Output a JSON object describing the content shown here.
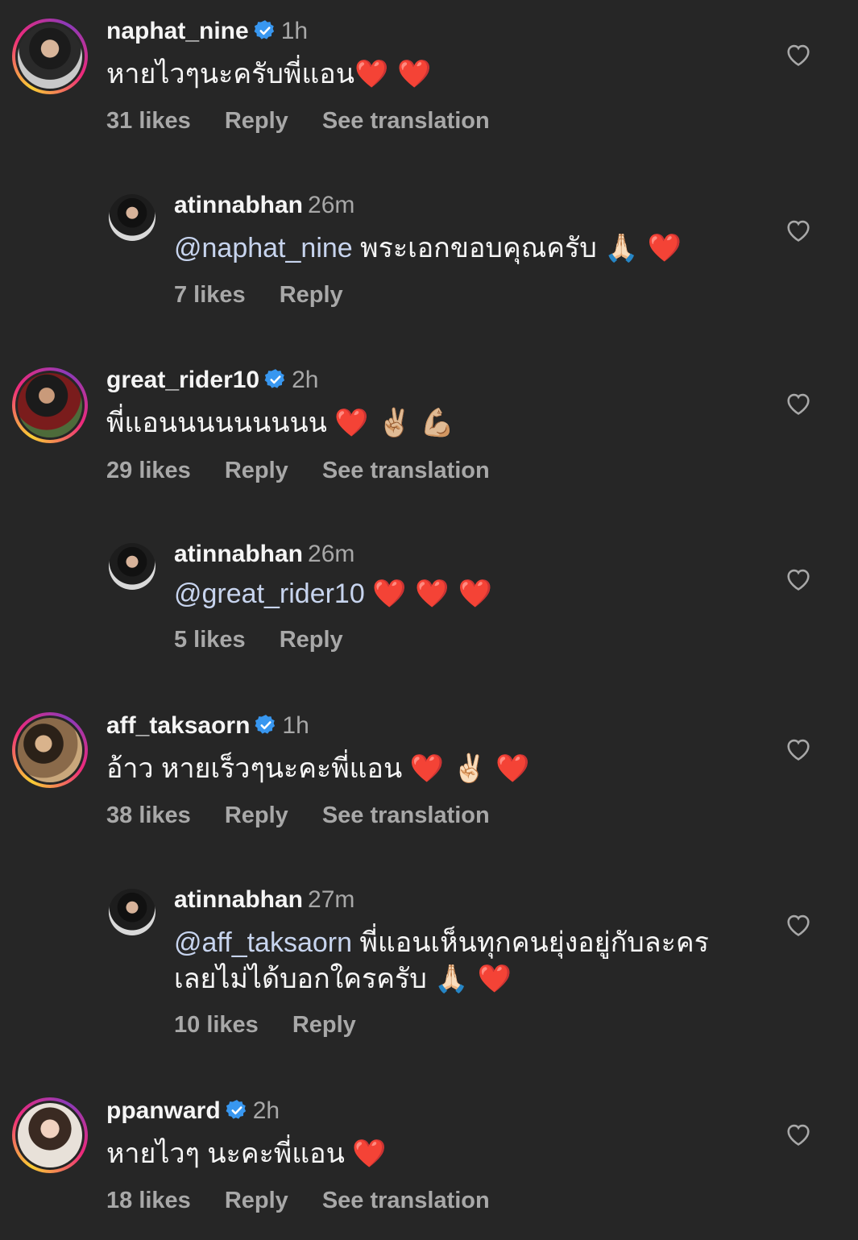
{
  "comments": [
    {
      "username": "naphat_nine",
      "verified": true,
      "time": "1h",
      "text": "หายไวๆนะครับพี่แอน",
      "emoji": "❤️ ❤️",
      "likes": "31 likes",
      "reply": "Reply",
      "translate": "See translation"
    },
    {
      "username": "atinnabhan",
      "verified": false,
      "time": "26m",
      "mention": "@naphat_nine",
      "text": "พระเอกขอบคุณครับ",
      "emoji": "🙏🏻 ❤️",
      "likes": "7 likes",
      "reply": "Reply"
    },
    {
      "username": "great_rider10",
      "verified": true,
      "time": "2h",
      "text": "พี่แอนนนนนนนนน",
      "emoji": "❤️ ✌🏼 💪🏼",
      "likes": "29 likes",
      "reply": "Reply",
      "translate": "See translation"
    },
    {
      "username": "atinnabhan",
      "verified": false,
      "time": "26m",
      "mention": "@great_rider10",
      "text": "",
      "emoji": "❤️ ❤️ ❤️",
      "likes": "5 likes",
      "reply": "Reply"
    },
    {
      "username": "aff_taksaorn",
      "verified": true,
      "time": "1h",
      "text": "อ้าว หายเร็วๆนะคะพี่แอน",
      "emoji": "❤️ ✌🏻 ❤️",
      "likes": "38 likes",
      "reply": "Reply",
      "translate": "See translation"
    },
    {
      "username": "atinnabhan",
      "verified": false,
      "time": "27m",
      "mention": "@aff_taksaorn",
      "text": "พี่แอนเห็นทุกคนยุ่งอยู่กับละคร",
      "text2": "เลยไม่ได้บอกใครครับ",
      "emoji": "🙏🏻 ❤️",
      "likes": "10 likes",
      "reply": "Reply"
    },
    {
      "username": "ppanward",
      "verified": true,
      "time": "2h",
      "text": "หายไวๆ นะคะพี่แอน",
      "emoji": "❤️",
      "likes": "18 likes",
      "reply": "Reply",
      "translate": "See translation"
    }
  ],
  "colors": {
    "background": "#262626",
    "text": "#f5f5f5",
    "secondary": "#a8a8a8",
    "mention": "#c7d4ee",
    "verified": "#3897f0"
  },
  "icons": {
    "like": "heart-outline-icon",
    "verified": "verified-badge-icon"
  }
}
